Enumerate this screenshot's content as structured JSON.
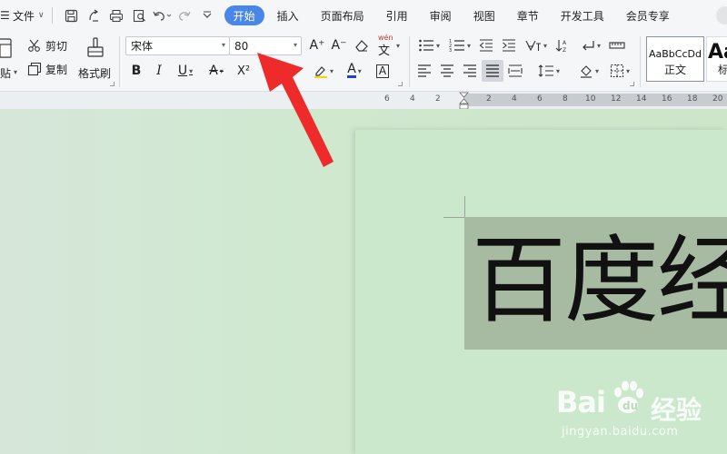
{
  "menubar": {
    "file_label": "文件",
    "tabs": [
      {
        "label": "开始",
        "active": true
      },
      {
        "label": "插入"
      },
      {
        "label": "页面布局"
      },
      {
        "label": "引用"
      },
      {
        "label": "审阅"
      },
      {
        "label": "视图"
      },
      {
        "label": "章节"
      },
      {
        "label": "开发工具"
      },
      {
        "label": "会员专享"
      }
    ],
    "active_tab_color": "#4a86e8"
  },
  "ribbon": {
    "paste_label": "贴",
    "cut_label": "剪切",
    "copy_label": "复制",
    "format_painter_label": "格式刷",
    "font_name": "宋体",
    "font_size": "80",
    "grow_font_label": "A⁺",
    "shrink_font_label": "A⁻",
    "phonetic_label": "wén",
    "bold_label": "B",
    "italic_label": "I",
    "underline_label": "U",
    "strike_label": "A",
    "superscript_label": "X²",
    "font_color_label": "A",
    "char_border_label": "A",
    "styles": [
      {
        "sample": "AaBbCcDd",
        "name": "正文"
      },
      {
        "sample": "Aa",
        "name": "标"
      }
    ]
  },
  "ruler": {
    "ticks": [
      "6",
      "4",
      "2",
      "2",
      "4",
      "6",
      "8",
      "10",
      "12",
      "14",
      "16",
      "18",
      "20"
    ]
  },
  "document": {
    "selected_text": "百度经",
    "selection_color": "#a7baa2",
    "page_color": "#cce8cc"
  },
  "watermark": {
    "logo_text": "Bai",
    "logo_suffix": "经验",
    "url": "jingyan.baidu.com"
  },
  "annotation": {
    "arrow_color": "#ef2a2a"
  }
}
